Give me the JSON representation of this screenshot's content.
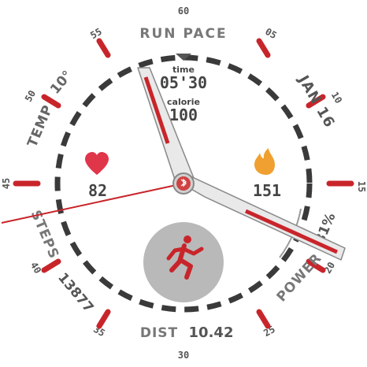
{
  "watchface": {
    "seconds_labels": [
      "60",
      "05",
      "10",
      "15",
      "20",
      "25",
      "30",
      "35",
      "40",
      "45",
      "50",
      "55"
    ],
    "complications": {
      "run_pace": {
        "label": "RUN PACE"
      },
      "temp": {
        "label": "TEMP",
        "value": "10°"
      },
      "date": {
        "value": "JAN 16"
      },
      "steps": {
        "label": "STEPS",
        "value": "13877"
      },
      "power": {
        "label": "POWER",
        "value": "81%"
      },
      "dist": {
        "label": "DIST",
        "value": "10.42"
      }
    },
    "center": {
      "time_label": "time",
      "time_value": "05'30",
      "calories_label": "calorie",
      "calories_value": "100",
      "heart_rate": "82",
      "calories_burned": "151"
    },
    "icons": [
      "heart-icon",
      "flame-icon",
      "runner-icon",
      "bluetooth-icon",
      "triangle-down-icon"
    ],
    "colors": {
      "accent_red": "#c8252b",
      "bezel_text": "#555555",
      "heart": "#e0364a",
      "flame": "#f0a030",
      "dial_gray": "#b9b9b9",
      "hand_fill": "#e9e9e9"
    }
  }
}
